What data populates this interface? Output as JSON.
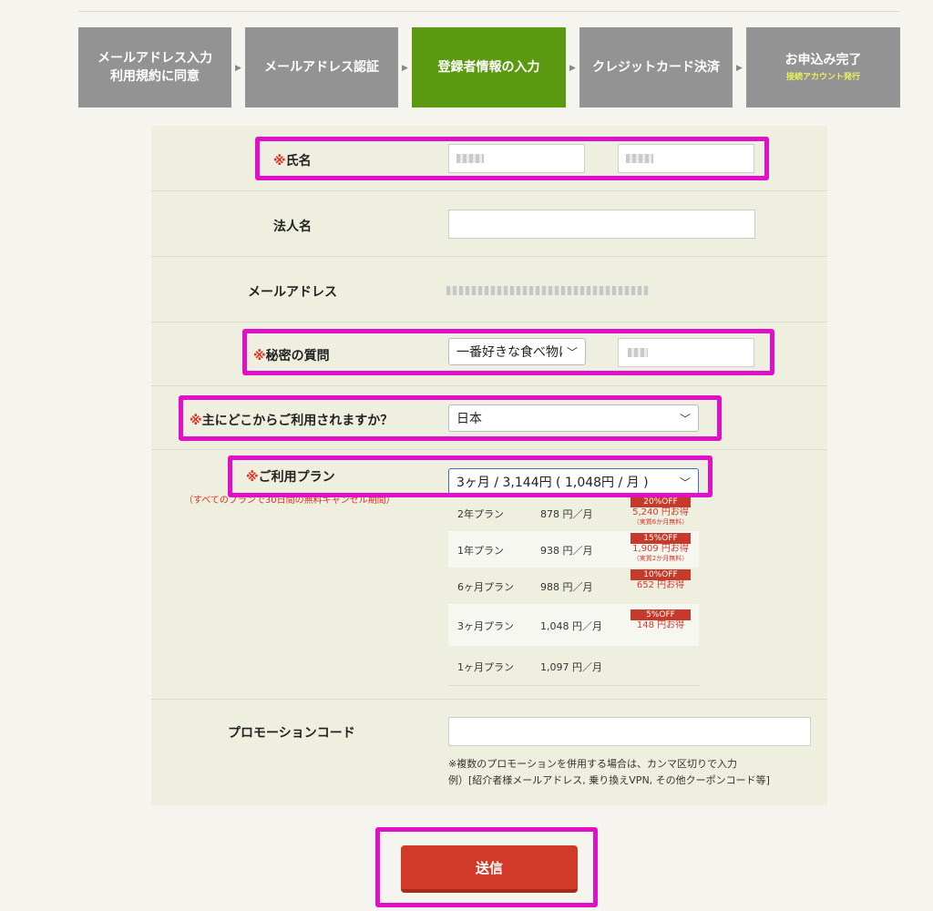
{
  "steps": [
    {
      "label_line1": "メールアドレス入力",
      "label_line2": "利用規約に同意",
      "sub": ""
    },
    {
      "label_line1": "メールアドレス認証",
      "label_line2": "",
      "sub": ""
    },
    {
      "label_line1": "登録者情報の入力",
      "label_line2": "",
      "sub": ""
    },
    {
      "label_line1": "クレジットカード決済",
      "label_line2": "",
      "sub": ""
    },
    {
      "label_line1": "お申込み完了",
      "label_line2": "",
      "sub": "接続アカウント発行"
    }
  ],
  "active_step_index": 2,
  "step_arrow": "▶",
  "required_mark": "※",
  "fields": {
    "name_label": "氏名",
    "company_label": "法人名",
    "company_value": "",
    "email_label": "メールアドレス",
    "secret_label": "秘密の質問",
    "secret_select": "一番好きな食べ物は",
    "country_label": "主にどこからご利用されますか？",
    "country_select": "日本",
    "plan_label": "ご利用プラン",
    "plan_select": "3ヶ月 / 3,144円 ( 1,048円 / 月 )",
    "plan_note": "（すべてのプランで30日間の無料キャンセル期間）",
    "promo_label": "プロモーションコード",
    "promo_value": "",
    "promo_note_line1": "※複数のプロモーションを併用する場合は、カンマ区切りで入力",
    "promo_note_line2": "例）[紹介者様メールアドレス, 乗り換えVPN, その他クーポンコード等]"
  },
  "plans": [
    {
      "name": "2年プラン",
      "price": "878 円／月",
      "off": "20%OFF",
      "save": "5,240 円お得",
      "note": "（実質6か月無料）"
    },
    {
      "name": "1年プラン",
      "price": "938 円／月",
      "off": "15%OFF",
      "save": "1,909 円お得",
      "note": "（実質2か月無料）"
    },
    {
      "name": "6ヶ月プラン",
      "price": "988 円／月",
      "off": "10%OFF",
      "save": "652 円お得",
      "note": ""
    },
    {
      "name": "3ヶ月プラン",
      "price": "1,048 円／月",
      "off": "5%OFF",
      "save": "148 円お得",
      "note": ""
    },
    {
      "name": "1ヶ月プラン",
      "price": "1,097 円／月",
      "off": "",
      "save": "",
      "note": ""
    }
  ],
  "submit_label": "送信",
  "chevron": "﹀",
  "colors": {
    "active_step": "#5b9a10",
    "inactive_step": "#939393",
    "highlight": "#e010c8",
    "submit": "#d13a28",
    "required": "#e0301e"
  }
}
